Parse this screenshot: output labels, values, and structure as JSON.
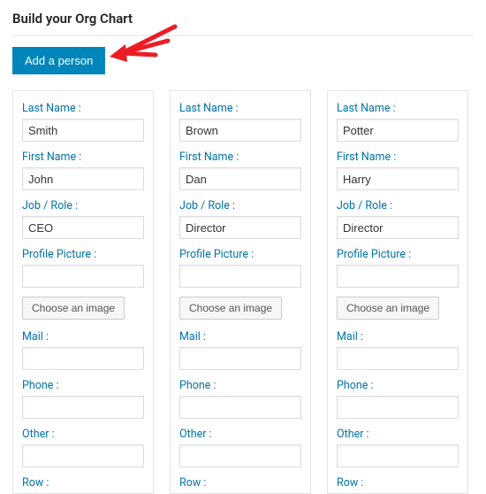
{
  "page": {
    "title": "Build your Org Chart"
  },
  "buttons": {
    "add_person": "Add a person",
    "choose_image": "Choose an image"
  },
  "labels": {
    "last_name": "Last Name :",
    "first_name": "First Name :",
    "job_role": "Job / Role :",
    "profile_picture": "Profile Picture :",
    "mail": "Mail :",
    "phone": "Phone :",
    "other": "Other :",
    "row": "Row :"
  },
  "people": [
    {
      "last_name": "Smith",
      "first_name": "John",
      "job": "CEO",
      "picture": "",
      "mail": "",
      "phone": "",
      "other": ""
    },
    {
      "last_name": "Brown",
      "first_name": "Dan",
      "job": "Director",
      "picture": "",
      "mail": "",
      "phone": "",
      "other": ""
    },
    {
      "last_name": "Potter",
      "first_name": "Harry",
      "job": "Director",
      "picture": "",
      "mail": "",
      "phone": "",
      "other": ""
    }
  ]
}
